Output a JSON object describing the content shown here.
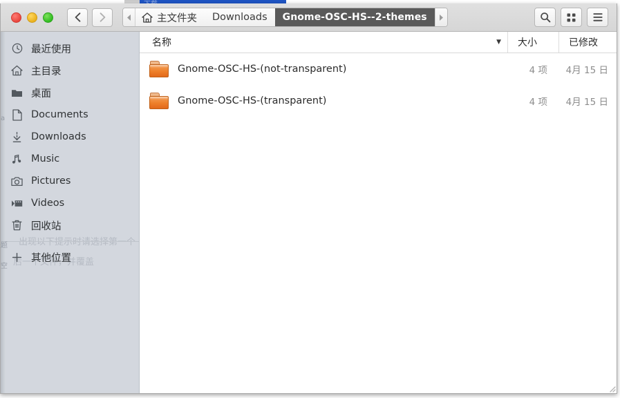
{
  "window": {
    "traffic_lights": [
      {
        "name": "close",
        "color": "#e8453c"
      },
      {
        "name": "minimize",
        "color": "#e9b01b"
      },
      {
        "name": "maximize",
        "color": "#2fbb1f"
      }
    ]
  },
  "background_window": {
    "titlebar_color": "#1f55c4",
    "title_text": "下载"
  },
  "header": {
    "nav": {
      "back_label": "‹",
      "forward_label": "›",
      "back_name": "back-button",
      "forward_name": "forward-button"
    },
    "breadcrumb": {
      "left_scroll": "◂",
      "right_scroll": "▸",
      "items": [
        {
          "label": "主文件夹",
          "icon": "home-icon",
          "active": false
        },
        {
          "label": "Downloads",
          "icon": "",
          "active": false
        },
        {
          "label": "Gnome-OSC-HS--2-themes",
          "icon": "",
          "active": true
        }
      ]
    },
    "actions": [
      {
        "name": "search-button",
        "icon": "search-icon"
      },
      {
        "name": "view-grid-button",
        "icon": "grid-icon"
      },
      {
        "name": "menu-button",
        "icon": "hamburger-icon"
      }
    ]
  },
  "sidebar": {
    "background": "#d3d7de",
    "items": [
      {
        "label": "最近使用",
        "icon": "clock-icon"
      },
      {
        "label": "主目录",
        "icon": "home-icon"
      },
      {
        "label": "桌面",
        "icon": "folder-icon"
      },
      {
        "label": "Documents",
        "icon": "document-icon"
      },
      {
        "label": "Downloads",
        "icon": "download-icon"
      },
      {
        "label": "Music",
        "icon": "music-icon"
      },
      {
        "label": "Pictures",
        "icon": "camera-icon"
      },
      {
        "label": "Videos",
        "icon": "video-icon"
      },
      {
        "label": "回收站",
        "icon": "trash-icon"
      }
    ],
    "other_locations": {
      "label": "其他位置",
      "icon": "plus-icon"
    }
  },
  "file_list": {
    "columns": [
      {
        "label": "名称",
        "sorted": true,
        "sort_caret": "▼"
      },
      {
        "label": "大小"
      },
      {
        "label": "已修改"
      }
    ],
    "rows": [
      {
        "name": "Gnome-OSC-HS-(not-transparent)",
        "size": "4 项",
        "modified": "4月 15 日",
        "icon": "folder-icon"
      },
      {
        "name": "Gnome-OSC-HS-(transparent)",
        "size": "4 项",
        "modified": "4月 15 日",
        "icon": "folder-icon"
      }
    ]
  }
}
